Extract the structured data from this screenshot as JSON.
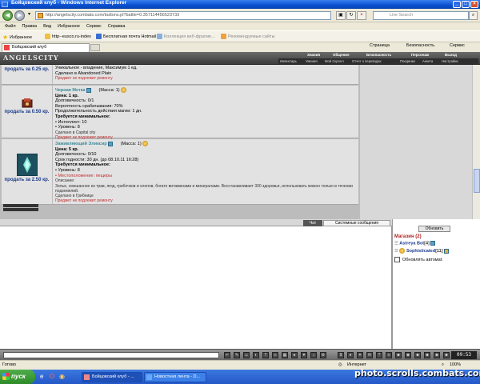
{
  "window": {
    "title": "Бойцовский клуб - Windows Internet Explorer"
  },
  "address": {
    "url": "http://angelscity.combats.com/buttons.pl?battle=0.357114456523733"
  },
  "search": {
    "placeholder": "Live Search"
  },
  "menu": [
    "Файл",
    "Правка",
    "Вид",
    "Избранное",
    "Сервис",
    "Справка"
  ],
  "favorites": {
    "label": "Избранное",
    "items": [
      "http--eusco.ru-index",
      "Бесплатная почта Hotmail",
      "Коллекция веб-фрагме...",
      "Рекомендуемые сайты"
    ]
  },
  "tab": {
    "label": "Бойцовский клуб"
  },
  "ie_tools": {
    "page": "Страница",
    "security": "Безопасность",
    "service": "Сервис"
  },
  "game": {
    "logo": "ANGELSCITY",
    "topnav": [
      "Знания",
      "Общение",
      "Безопасность",
      "Персонаж",
      "Выход"
    ],
    "subnav": [
      "Инвентарь",
      "Умения",
      "Мой Скролл",
      "Отчет о переводах",
      "Поединки",
      "Анкета",
      "Настройки"
    ]
  },
  "items": [
    {
      "sell": "продать за 0.25 кр.",
      "lines": [
        "Уникальное - владение, Максимум 1 ед.",
        "Сделано в Abandoned Plain"
      ],
      "warn": "Предмет не подлежит ремонту"
    },
    {
      "sell": "продать за 0.50 кр.",
      "name": "Черная Метка",
      "mass": "(Масса: 1)",
      "price": "Цена: 1 кр.",
      "lines": [
        "Долговечность: 0/1",
        "Вероятность срабатывания: 70%",
        "Продолжительность действия магии: 1 дн."
      ],
      "req_title": "Требуется минимальное:",
      "reqs": [
        "• Интеллект: 10",
        "• Уровень: 8"
      ],
      "made": "Сделано в Capital city",
      "warn": "Предмет не подлежит ремонту"
    },
    {
      "sell": "продать за 2.50 кр.",
      "name": "Заживляющий Эликсир",
      "mass": "(Масса: 1)",
      "price": "Цена: 5 кр.",
      "lines": [
        "Долговечность: 0/10",
        "Срок годности: 30 дн. (до 08.10.11 16:28)"
      ],
      "req_title": "Требуется минимальное:",
      "reqs": [
        "• Уровень: 8"
      ],
      "req_warn": "• Местоположение: пещеры",
      "desc_label": "Описание:",
      "desc": "Зелье, смешанное из трав, ягод, грибочков и хлопов, богато витаминами и минералами. Восстанавливает 300 здоровья, использовать можно только в течении подземелий.",
      "made": "Сделано в Грибнице",
      "warn": "Предмет не подлежит ремонту"
    }
  ],
  "chat_tabs": {
    "chat": "Чат",
    "system": "Системные сообщения"
  },
  "right": {
    "refresh": "Обновить",
    "shop": "Магазин (2)",
    "users": [
      {
        "name": "Astreya Bot",
        "level": "[4]"
      },
      {
        "name": "Sophisticated",
        "level": "[11]"
      }
    ],
    "auto": "Обновлять автомат."
  },
  "clock": "09:53",
  "status": {
    "left": "Готово",
    "zone": "Интернет",
    "zoom": "100%"
  },
  "taskbar": {
    "start": "пуск",
    "tasks": [
      "Бойцовский клуб - ...",
      "Новостная лента - D..."
    ]
  },
  "watermark": "photo.scrolls.combats.com"
}
